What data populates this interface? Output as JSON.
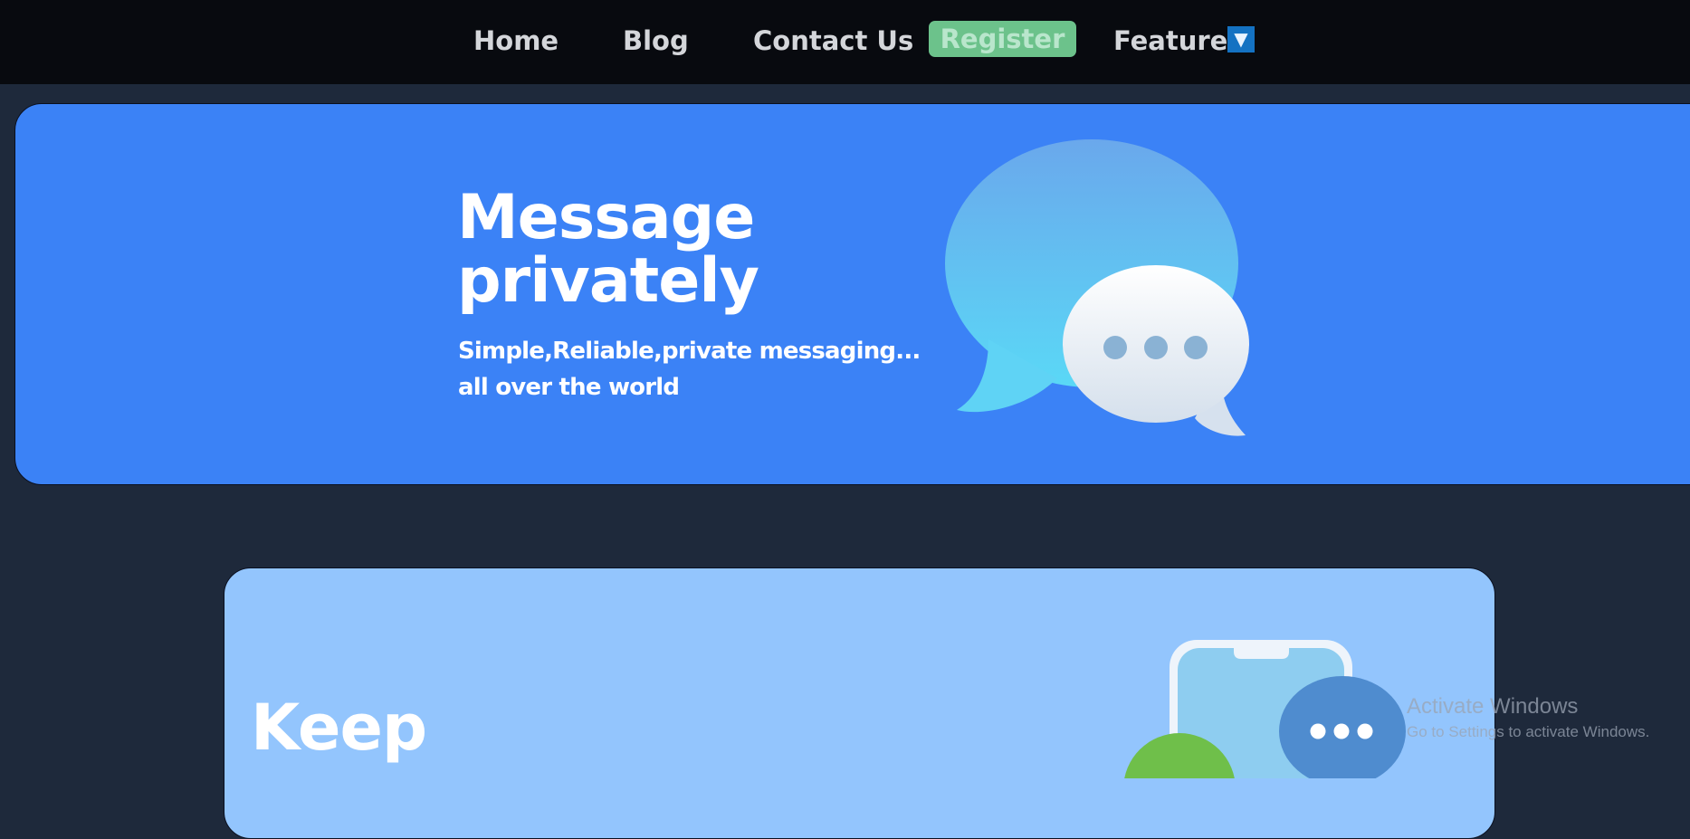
{
  "nav": {
    "items": [
      {
        "label": "Home"
      },
      {
        "label": "Blog"
      },
      {
        "label": "Contact Us"
      }
    ],
    "register_label": "Register",
    "features_label": "Features",
    "dropdown_glyph": "▼"
  },
  "hero": {
    "title": "Message privately",
    "subtitle": "Simple,Reliable,private messaging... all over the world",
    "illustration_icon": "chat-bubbles-icon"
  },
  "feature": {
    "title": "Keep",
    "illustration_icon": "phone-chat-icon"
  },
  "watermark": {
    "line1": "Activate Windows",
    "line2": "Go to Settings to activate Windows."
  },
  "colors": {
    "nav_bg": "#080a0f",
    "page_bg": "#1e293b",
    "hero_bg": "#3b82f6",
    "feature_bg": "#93c5fd",
    "register_bg": "#6cc28b",
    "dropdown_bg": "#1472c2"
  }
}
